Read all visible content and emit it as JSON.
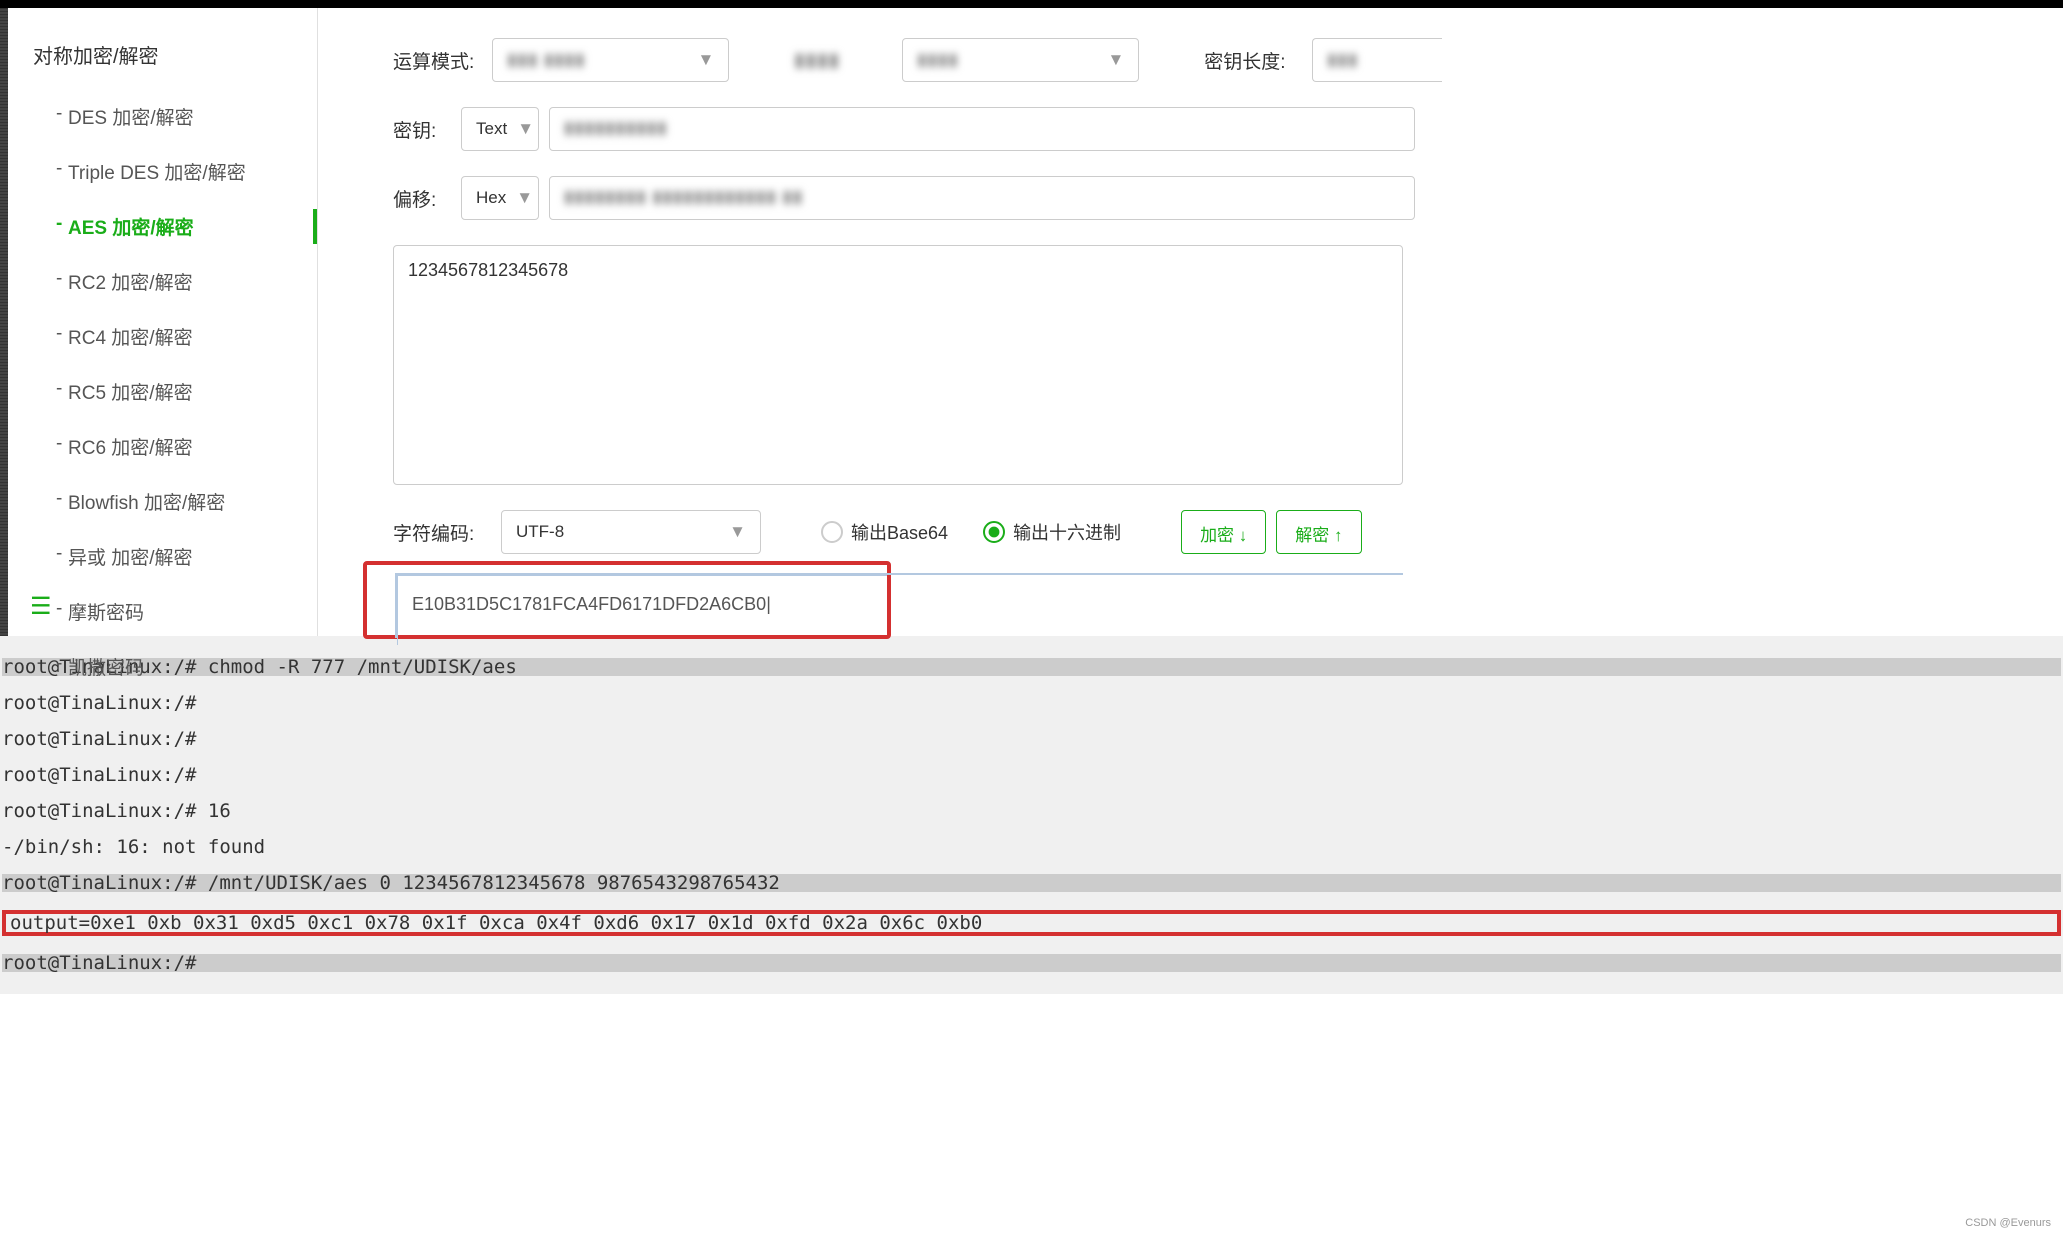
{
  "sidebar": {
    "title": "对称加密/解密",
    "items": [
      {
        "label": "DES  加密/解密"
      },
      {
        "label": "Triple DES  加密/解密"
      },
      {
        "label": "AES  加密/解密"
      },
      {
        "label": "RC2  加密/解密"
      },
      {
        "label": "RC4  加密/解密"
      },
      {
        "label": "RC5  加密/解密"
      },
      {
        "label": "RC6  加密/解密"
      },
      {
        "label": "Blowfish  加密/解密"
      },
      {
        "label": "异或  加密/解密"
      },
      {
        "label": "摩斯密码"
      },
      {
        "label": "凯撒密码"
      }
    ]
  },
  "form": {
    "mode_label": "运算模式:",
    "mode_blur": "▮▮▮ ▮▮▮▮",
    "field2_blur": "▮▮▮▮",
    "field2_select_blur": "▮▮▮▮",
    "keylen_label": "密钥长度:",
    "keylen_blur": "▮▮▮",
    "key_label": "密钥:",
    "key_select": "Text",
    "key_input_blur": "▮▮▮▮▮▮▮▮▮▮",
    "iv_label": "偏移:",
    "iv_select": "Hex",
    "iv_input_blur": "▮▮▮▮▮▮▮▮  ▮▮▮▮▮▮▮▮▮▮▮▮  ▮▮",
    "input_text": "1234567812345678",
    "charset_label": "字符编码:",
    "charset_value": "UTF-8",
    "output_base64": "输出Base64",
    "output_hex": "输出十六进制",
    "encrypt_btn": "加密 ↓",
    "decrypt_btn": "解密 ↑",
    "output_text": "E10B31D5C1781FCA4FD6171DFD2A6CB0|"
  },
  "terminal": {
    "line1": "root@TinaLinux:/# chmod -R 777 /mnt/UDISK/aes",
    "line2": "root@TinaLinux:/#",
    "line3": "root@TinaLinux:/#",
    "line4": "root@TinaLinux:/#",
    "line5": "root@TinaLinux:/# 16",
    "line6": "-/bin/sh: 16: not found",
    "line7": "root@TinaLinux:/# /mnt/UDISK/aes 0 1234567812345678 9876543298765432",
    "line8": "output=0xe1 0xb 0x31 0xd5 0xc1 0x78 0x1f 0xca 0x4f 0xd6 0x17 0x1d 0xfd 0x2a 0x6c 0xb0",
    "line9": "root@TinaLinux:/#"
  },
  "watermark": "CSDN @Evenurs"
}
